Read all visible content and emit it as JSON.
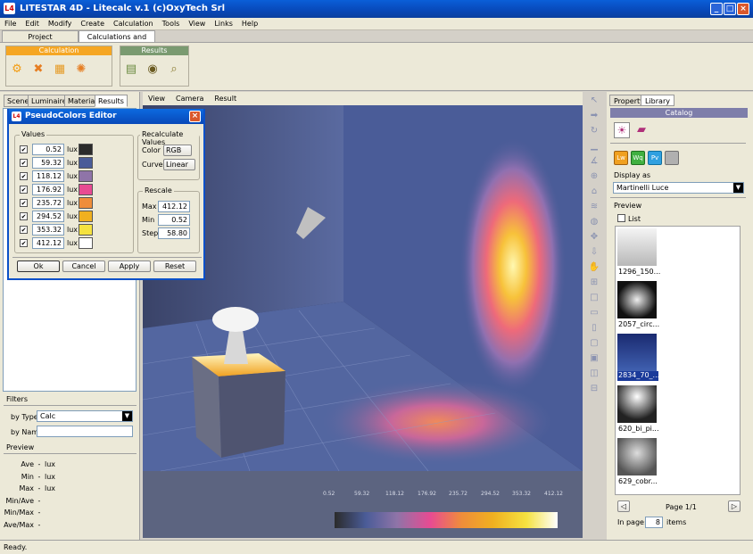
{
  "window": {
    "title": "LITESTAR 4D - Litecalc v.1     (c)OxyTech Srl",
    "logo": "L4"
  },
  "menu": [
    "File",
    "Edit",
    "Modify",
    "Create",
    "Calculation",
    "Tools",
    "View",
    "Links",
    "Help"
  ],
  "top_tabs": [
    "Project",
    "Calculations and Results"
  ],
  "toolbar": {
    "calculation_label": "Calculation",
    "results_label": "Results",
    "calculation_icons": [
      "calc-scene-icon",
      "calc-cancel-icon",
      "calc-film-icon",
      "calc-lifebuoy-icon",
      "calc-camera-icon"
    ],
    "results_icons": [
      "report-icon",
      "eye-icon",
      "search-icon"
    ],
    "calculation_color": "#f5a623",
    "results_color": "#7a9a70"
  },
  "left_panel": {
    "tabs": [
      "Scene",
      "Luminaires",
      "Materials",
      "Results"
    ],
    "filters_label": "Filters",
    "by_type_label": "by Type",
    "by_type_value": "Calc",
    "by_name_label": "by Name",
    "by_name_value": "",
    "preview_label": "Preview",
    "preview_rows": [
      {
        "label": "Ave",
        "dash": "-",
        "unit": "lux"
      },
      {
        "label": "Min",
        "dash": "-",
        "unit": "lux"
      },
      {
        "label": "Max",
        "dash": "-",
        "unit": "lux"
      },
      {
        "label": "Min/Ave",
        "dash": "-",
        "unit": ""
      },
      {
        "label": "Min/Max",
        "dash": "-",
        "unit": ""
      },
      {
        "label": "Ave/Max",
        "dash": "-",
        "unit": ""
      }
    ]
  },
  "viewport": {
    "menu": [
      "View",
      "Camera",
      "Result"
    ],
    "scale_labels": [
      "0.52",
      "59.32",
      "118.12",
      "176.92",
      "235.72",
      "294.52",
      "353.32",
      "412.12"
    ]
  },
  "dialog": {
    "title": "PseudoColors Editor",
    "values_label": "Values",
    "unit": "lux",
    "rows": [
      {
        "value": "0.52",
        "color": "#2b2b2b"
      },
      {
        "value": "59.32",
        "color": "#4a5c98"
      },
      {
        "value": "118.12",
        "color": "#8f74a8"
      },
      {
        "value": "176.92",
        "color": "#e84b92"
      },
      {
        "value": "235.72",
        "color": "#ef8d3a"
      },
      {
        "value": "294.52",
        "color": "#f0b020"
      },
      {
        "value": "353.32",
        "color": "#f5e240"
      },
      {
        "value": "412.12",
        "color": "#ffffff"
      }
    ],
    "recalc_label": "Recalculate Values",
    "color_label": "Color",
    "color_value": "RGB",
    "curve_label": "Curve",
    "curve_value": "Linear",
    "rescale_label": "Rescale",
    "max_label": "Max",
    "max_value": "412.12",
    "min_label": "Min",
    "min_value": "0.52",
    "step_label": "Step",
    "step_value": "58.80",
    "ok": "Ok",
    "cancel": "Cancel",
    "apply": "Apply",
    "reset": "Reset"
  },
  "right_panel": {
    "tabs": [
      "Property",
      "Library"
    ],
    "catalog_label": "Catalog",
    "lib_buttons": [
      "Lw",
      "Wq",
      "Pv"
    ],
    "display_as_label": "Display as",
    "display_as_value": "Martinelli Luce",
    "preview_label": "Preview",
    "list_label": "List",
    "thumbs": [
      "1296_150...",
      "2057_circ...",
      "2834_70_...",
      "620_bi_pi...",
      "629_cobr..."
    ],
    "page_label": "Page 1/1",
    "in_page_label": "In page:",
    "in_page_value": "8",
    "items_label": "items"
  },
  "status": "Ready."
}
